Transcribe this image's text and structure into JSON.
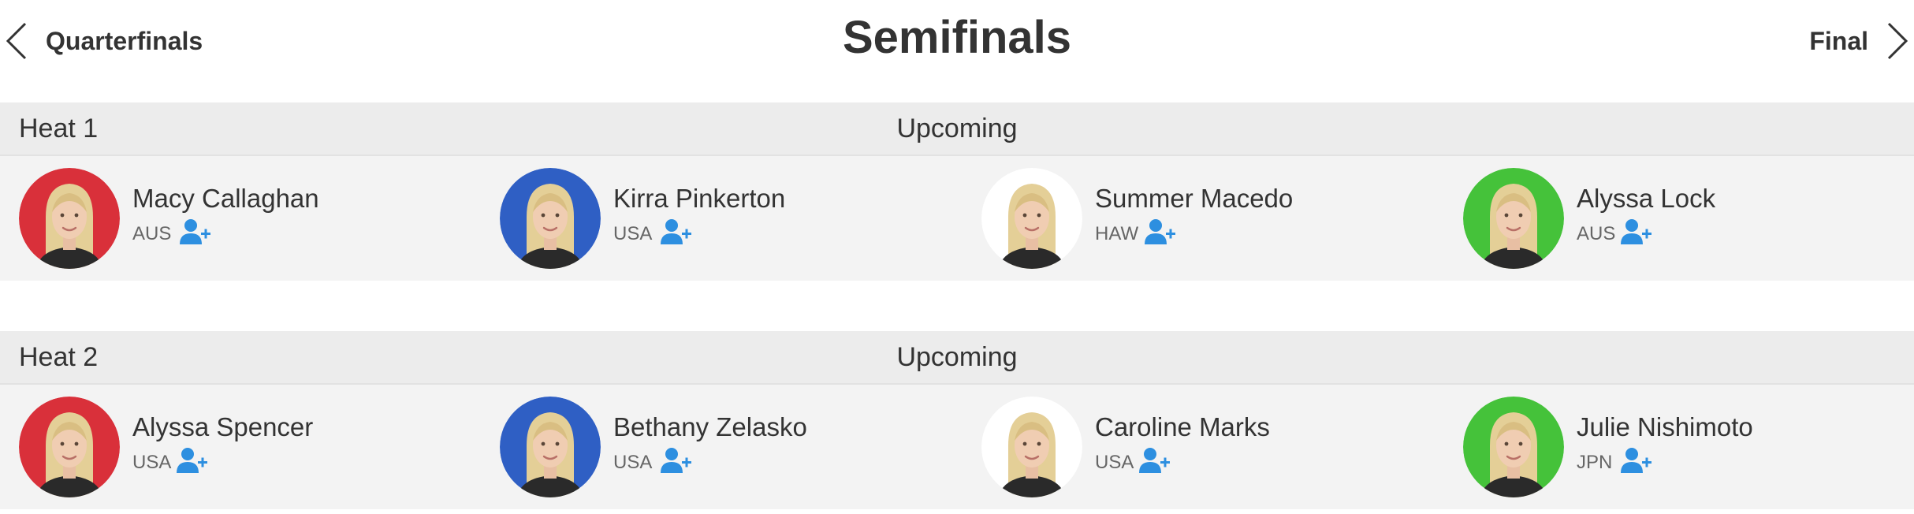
{
  "header": {
    "prev_label": "Quarterfinals",
    "title": "Semifinals",
    "next_label": "Final"
  },
  "heats": [
    {
      "name": "Heat 1",
      "status": "Upcoming",
      "athletes": [
        {
          "name": "Macy Callaghan",
          "country": "AUS",
          "jersey_color": "#d9303a"
        },
        {
          "name": "Kirra Pinkerton",
          "country": "USA",
          "jersey_color": "#2f5fc4"
        },
        {
          "name": "Summer Macedo",
          "country": "HAW",
          "jersey_color": "#ffffff"
        },
        {
          "name": "Alyssa Lock",
          "country": "AUS",
          "jersey_color": "#45c23a"
        }
      ]
    },
    {
      "name": "Heat 2",
      "status": "Upcoming",
      "athletes": [
        {
          "name": "Alyssa Spencer",
          "country": "USA",
          "jersey_color": "#d9303a"
        },
        {
          "name": "Bethany Zelasko",
          "country": "USA",
          "jersey_color": "#2f5fc4"
        },
        {
          "name": "Caroline Marks",
          "country": "USA",
          "jersey_color": "#ffffff"
        },
        {
          "name": "Julie Nishimoto",
          "country": "JPN",
          "jersey_color": "#45c23a"
        }
      ]
    }
  ],
  "icons": {
    "prev": "chevron-left-icon",
    "next": "chevron-right-icon",
    "follow": "add-user-icon"
  },
  "colors": {
    "follow_icon": "#2d8fe0",
    "header_band": "#ececec",
    "row_band": "#f3f3f3"
  }
}
